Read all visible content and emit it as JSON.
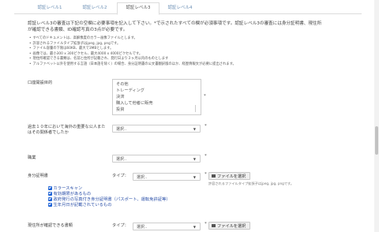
{
  "tabs": [
    {
      "label": "認証レベル1"
    },
    {
      "label": "認証レベル2"
    },
    {
      "label": "認証レベル3"
    },
    {
      "label": "認証レベル4"
    }
  ],
  "intro": {
    "line1": "認証レベル3の審査は下記の空欄に必要事項を記入して下さい。*で示されたすべての欄が必須事項です。認証レベル3の審査には身分証明書、現住所",
    "line2": "が確認できる書類、ID確認写真の3点が必要です。"
  },
  "bullets": [
    "すべてのドキュメントは、高解像度のカラー画像ファイルとします。",
    "許容されるファイルタイプ拡張子はjpeg, jpg, pngです。",
    "ファイル容量の下限は60KB、最大で3MBとします。",
    "画像では、最小300 x 300ピクセル、最大4000 x 4000ピクセルです。",
    "現住所確認できる書類は、名前と住所が記載され、発行日より３ヶ月以内のものとします",
    "アルファベット以外を使用する言語（日本語を除く）の場合、身分証明書の公文書翻訳版のほか、経歴情報文が必要に提出されます。"
  ],
  "purpose": {
    "label": "口座開設目的",
    "options": [
      "その他",
      "トレーディング",
      "決済",
      "購入して他者に販売",
      "投資"
    ],
    "required": "*"
  },
  "crime": {
    "label": "過去１０年において海外の重要な公人またはその関係者でしたか",
    "placeholder": "選択..",
    "required": "*"
  },
  "occupation": {
    "label": "職業",
    "placeholder": "選択..",
    "required": "*"
  },
  "id_doc": {
    "label": "身分証明書",
    "type_label": "タイプ：",
    "placeholder": "選択..",
    "required": "*",
    "file_button": "ファイルを選択",
    "file_hint": "許容されるファイルタイプ拡張子はjpeg, jpg, pngです。",
    "requirements": [
      "カラースキャン",
      "有効期限があるもの",
      "政府発行の写真付き身分証明書（パスポート、運転免許証等）",
      "生年月日が記載されているもの"
    ]
  },
  "address_doc": {
    "label": "現住所が確認できる書類",
    "type_label": "タイプ：",
    "placeholder": "選択..",
    "required": "*",
    "file_button": "ファイルを選択"
  },
  "icons": {
    "folder": "folder-icon",
    "caret": "caret-down-icon",
    "check": "checkbox-checked-icon"
  },
  "colors": {
    "link": "#6b8fb5",
    "checkbox": "#1e63d6",
    "check_text": "#2a4fa8"
  }
}
